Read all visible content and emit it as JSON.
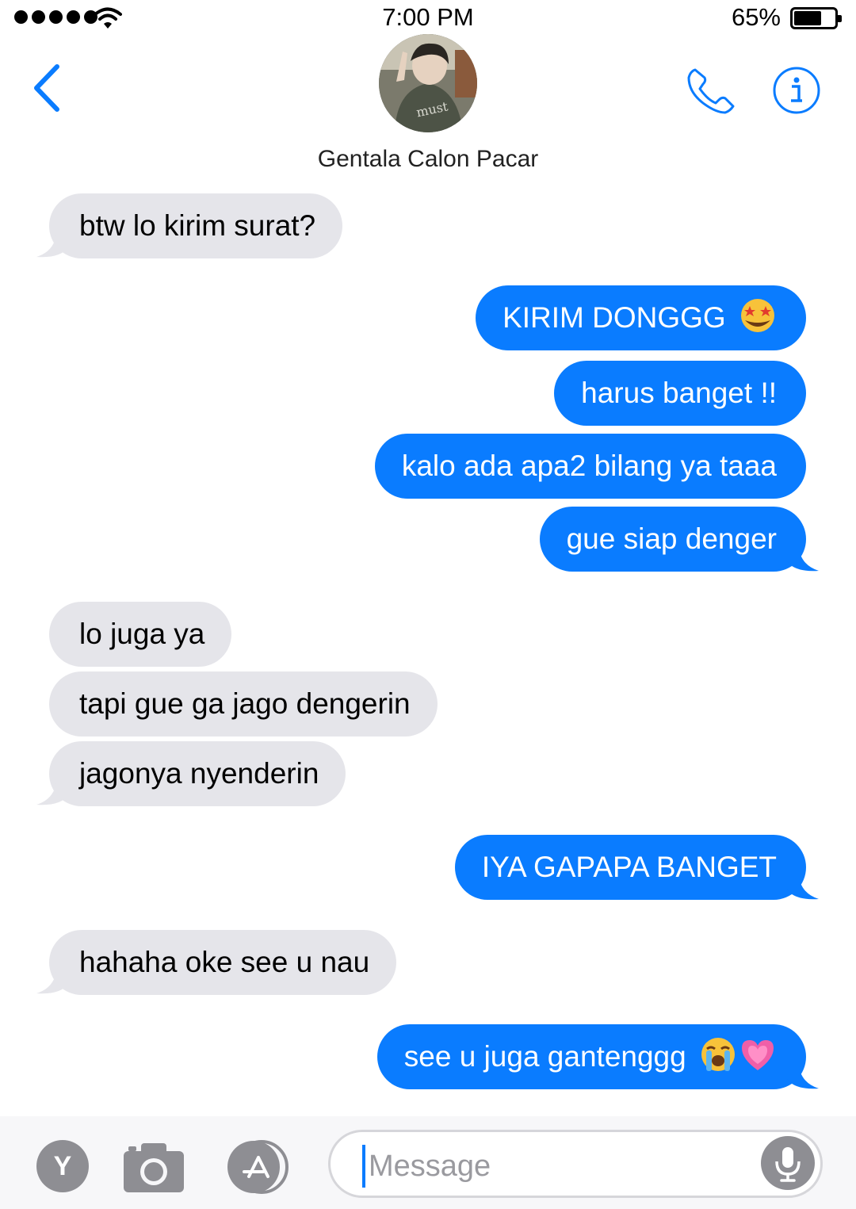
{
  "status_bar": {
    "time": "7:00 PM",
    "battery_percent": "65%",
    "battery_level": 0.65
  },
  "header": {
    "contact_name": "Gentala Calon Pacar",
    "back_icon": "chevron-left-icon",
    "call_icon": "phone-icon",
    "info_icon": "info-icon"
  },
  "messages": [
    {
      "from": "them",
      "text": "btw lo kirim surat?"
    },
    {
      "from": "me",
      "text": "KIRIM DONGGG",
      "emoji": [
        "star-struck-emoji"
      ]
    },
    {
      "from": "me",
      "text": "harus banget !!"
    },
    {
      "from": "me",
      "text": "kalo ada apa2 bilang ya taaa"
    },
    {
      "from": "me",
      "text": "gue siap denger"
    },
    {
      "from": "them",
      "text": "lo juga ya"
    },
    {
      "from": "them",
      "text": "tapi gue ga jago dengerin"
    },
    {
      "from": "them",
      "text": "jagonya nyenderin"
    },
    {
      "from": "me",
      "text": "IYA GAPAPA BANGET"
    },
    {
      "from": "them",
      "text": "hahaha oke see u nau"
    },
    {
      "from": "me",
      "text": "see u juga gantenggg",
      "emoji": [
        "loudly-crying-emoji",
        "growing-heart-emoji"
      ]
    }
  ],
  "composer": {
    "avatar_initial": "Y",
    "placeholder": "Message"
  },
  "colors": {
    "accent_blue": "#0a7cff",
    "incoming_bubble": "#e5e5ea",
    "icon_gray": "#8e8e93"
  }
}
